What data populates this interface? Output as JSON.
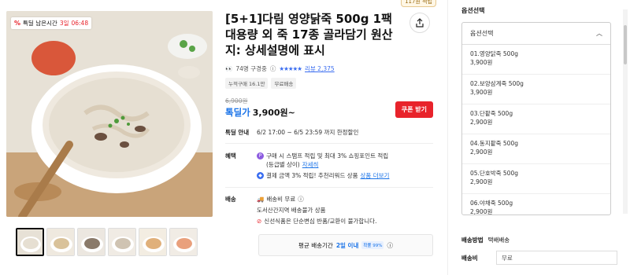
{
  "image": {
    "deal_label": "특딜 남은시간",
    "deal_days": "3일",
    "deal_time": "06:48"
  },
  "product": {
    "top_badge": "117원 적립",
    "title": "[5+1]다림 영양닭죽 500g 1팩 대용량 외 죽 17종 골라담기 원산지: 상세설명에 표시",
    "buyers": "74명 구경중",
    "stars": "★★★★★",
    "review": "리뷰 2,375",
    "tags": [
      "누적구매 16.1만",
      "무료배송"
    ],
    "original_price": "6,900원",
    "price_label": "톡딜가",
    "price": "3,900원~",
    "coupon": "쿠폰 받기"
  },
  "deal": {
    "label": "톡딜 안내",
    "text": "6/2 17:00 ~ 6/5 23:59 까지 한정할인"
  },
  "benefit": {
    "label": "혜택",
    "line1": "구매 시 스탬프 적립 및 최대 3% 쇼핑포인트 적립",
    "line1b": "(등급별 상이)",
    "line1_link": "자세히",
    "line2": "결제 금액 3% 적립! 추천리워드 상품",
    "line2_link": "상품 더보기"
  },
  "shipping": {
    "label": "배송",
    "fee": "배송비 무료",
    "region": "도서산간지역 배송불가 상품",
    "notice": "신선식품은 단순변심 반품/교환이 불가합니다.",
    "avg_prefix": "평균 배송기간",
    "avg_value": "2일 이내",
    "avg_badge": "확률 99%"
  },
  "options": {
    "title": "옵션선택",
    "dropdown_head": "옵션선택",
    "items": [
      {
        "name": "01.영양닭죽 500g",
        "price": "3,900원"
      },
      {
        "name": "02.보양삼계죽 500g",
        "price": "3,900원"
      },
      {
        "name": "03.단팥죽 500g",
        "price": "2,900원"
      },
      {
        "name": "04.동지팥죽 500g",
        "price": "2,900원"
      },
      {
        "name": "05.단호박죽 500g",
        "price": "2,900원"
      },
      {
        "name": "06.야채죽 500g",
        "price": "2,900원"
      }
    ],
    "ship_method_label": "배송방법",
    "ship_method_value": "택배배송",
    "ship_fee_label": "배송비",
    "ship_fee_value": "무료"
  },
  "colors": {
    "accent_blue": "#1a73e8",
    "coupon_red": "#e8232b",
    "star_blue": "#3a6df0"
  }
}
